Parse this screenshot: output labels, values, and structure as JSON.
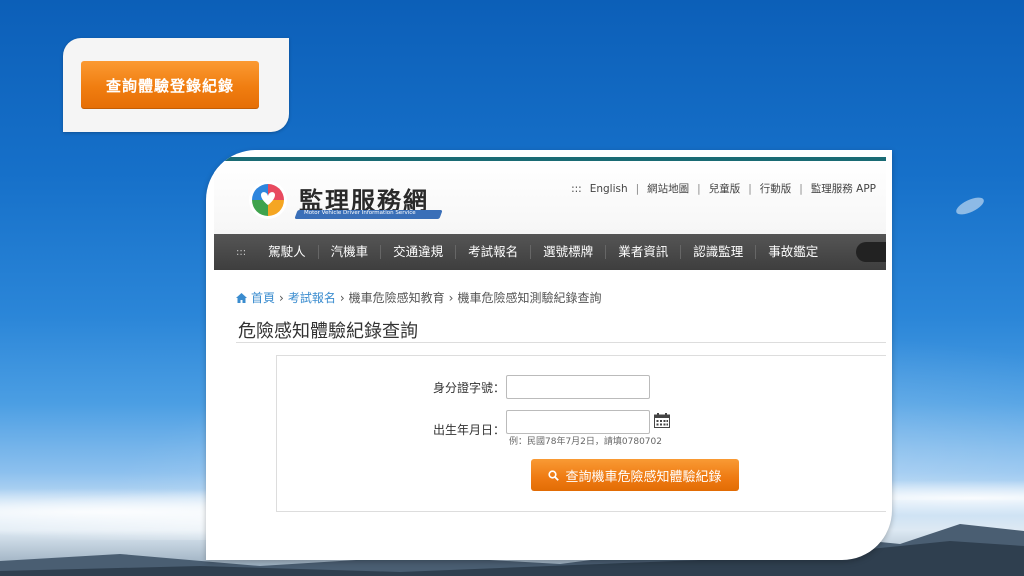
{
  "floating_button": {
    "label": "查詢體驗登錄紀錄"
  },
  "site": {
    "logo": {
      "title": "監理服務網",
      "subtitle": "Motor Vehicle Driver Information Service"
    },
    "toplinks": {
      "handle": ":::",
      "items": [
        "English",
        "網站地圖",
        "兒童版",
        "行動版",
        "監理服務 APP"
      ]
    },
    "nav": {
      "handle": ":::",
      "items": [
        "駕駛人",
        "汽機車",
        "交通違規",
        "考試報名",
        "選號標牌",
        "業者資訊",
        "認識監理",
        "事故鑑定"
      ]
    },
    "breadcrumb": {
      "home": "首頁",
      "items": [
        "考試報名",
        "機車危險感知教育",
        "機車危險感知測驗紀錄查詢"
      ],
      "separator": "›"
    },
    "page_title": "危險感知體驗紀錄查詢",
    "form": {
      "id_label": "身分證字號：",
      "id_value": "",
      "dob_label": "出生年月日：",
      "dob_value": "",
      "dob_hint": "例：民國78年7月2日，請填0780702",
      "submit_label": "查詢機車危險感知體驗紀錄"
    }
  },
  "colors": {
    "accent_orange": "#f07d10",
    "nav_dark": "#444444",
    "link_blue": "#3a8ccf",
    "teal_line": "#1a6b74"
  }
}
